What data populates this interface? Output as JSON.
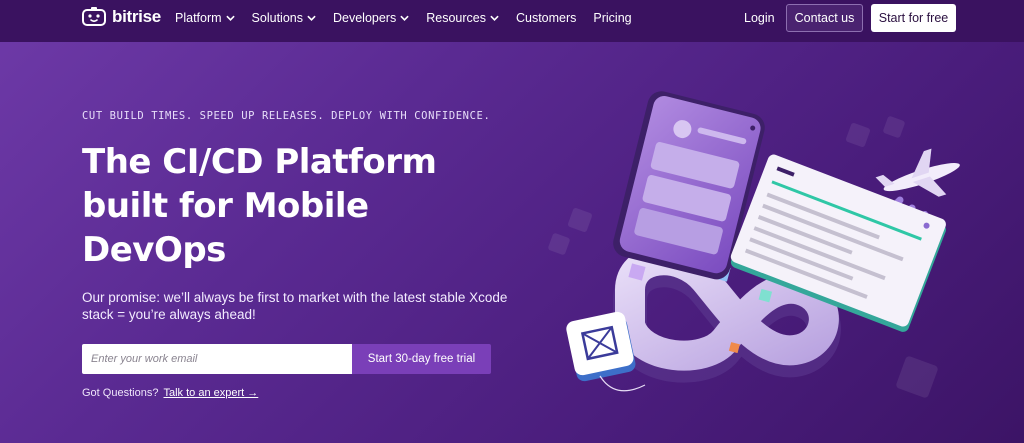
{
  "nav": {
    "brand": "bitrise",
    "menu": [
      {
        "label": "Platform",
        "dropdown": true
      },
      {
        "label": "Solutions",
        "dropdown": true
      },
      {
        "label": "Developers",
        "dropdown": true
      },
      {
        "label": "Resources",
        "dropdown": true
      },
      {
        "label": "Customers",
        "dropdown": false
      },
      {
        "label": "Pricing",
        "dropdown": false
      }
    ],
    "login": "Login",
    "contact": "Contact us",
    "start": "Start for free"
  },
  "hero": {
    "eyebrow": "CUT BUILD TIMES. SPEED UP RELEASES. DEPLOY WITH CONFIDENCE.",
    "headline_lines": [
      "The CI/CD Platform",
      "built for Mobile",
      "DevOps"
    ],
    "promise": "Our promise: we’ll always be first to market with the latest stable Xcode stack = you’re always ahead!",
    "email_placeholder": "Enter your work email",
    "cta": "Start 30-day free trial",
    "questions_prefix": "Got Questions?",
    "questions_link": "Talk to an expert →"
  },
  "colors": {
    "nav_bg": "#3a1260",
    "hero_start": "#6e3aa8",
    "hero_end": "#3c1466",
    "cta": "#7a3fb8"
  },
  "icons": [
    "bitrise-logo-icon",
    "chevron-down-icon",
    "phone-illustration",
    "dashboard-illustration",
    "airplane-illustration",
    "package-icon",
    "infinity-loop-illustration"
  ]
}
